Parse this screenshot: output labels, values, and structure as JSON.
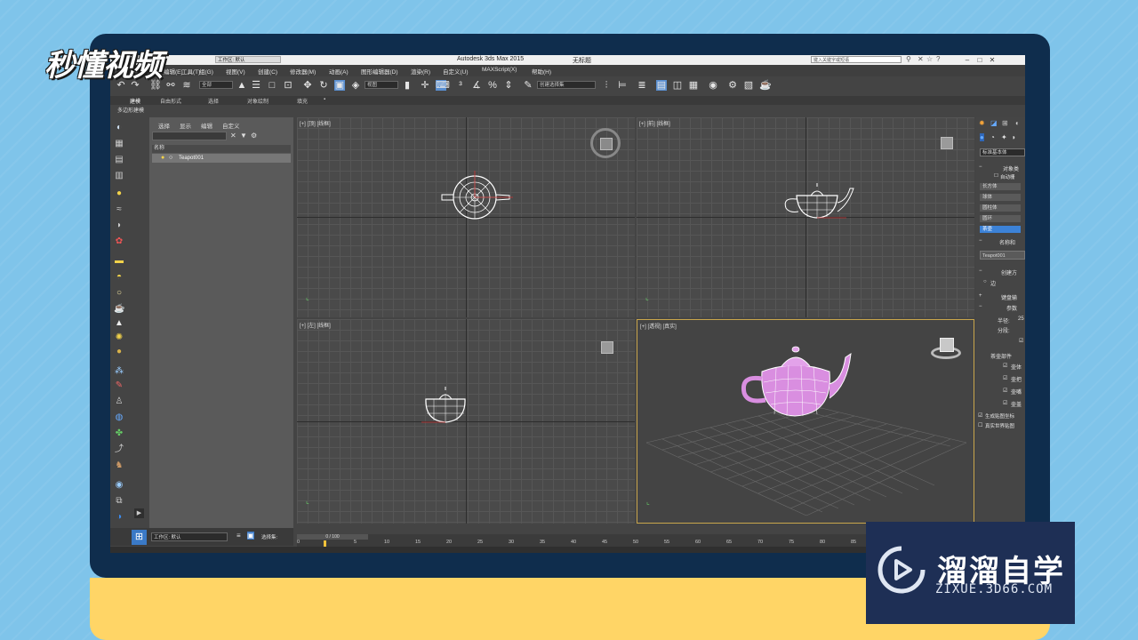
{
  "window": {
    "title": "Autodesk 3ds Max  2015",
    "doc_title": "无标题",
    "workspace": "工作区: 默认",
    "search_placeholder": "键入关键字或短语"
  },
  "menu": [
    "编辑(E)",
    "工具(T)",
    "组(G)",
    "视图(V)",
    "创建(C)",
    "修改器(M)",
    "动画(A)",
    "图形编辑器(D)",
    "渲染(R)",
    "自定义(U)",
    "MAXScript(X)",
    "帮助(H)"
  ],
  "toolbar": {
    "selection_filter": "全部",
    "view_dropdown": "视图",
    "named_selection": "创建选择集"
  },
  "ribbon_tabs": [
    "建模",
    "自由形式",
    "选择",
    "对象绘制",
    "填充"
  ],
  "ribbon_sub": "多边形建模",
  "scene_explorer": {
    "tabs": [
      "选择",
      "显示",
      "编辑",
      "自定义"
    ],
    "column_header": "名称",
    "items": [
      "Teapot001"
    ]
  },
  "viewports": [
    {
      "label": "[+] [顶] [线框]"
    },
    {
      "label": "[+] [前] [线框]"
    },
    {
      "label": "[+] [左] [线框]"
    },
    {
      "label": "[+] [透视] [真实]"
    }
  ],
  "command_panel": {
    "dropdown": "标准基本体",
    "object_type_title": "对象类",
    "autogrid": "自动栅",
    "buttons": [
      "长方体",
      "球体",
      "圆柱体",
      "圆环",
      "茶壶"
    ],
    "name_color_title": "名称和",
    "object_name": "Teapot001",
    "creation_method_title": "创建方",
    "edge_label": "边",
    "keyboard_entry_title": "键盘输",
    "parameters_title": "参数",
    "radius_label": "半径:",
    "radius_value": "25",
    "segments_label": "分段:",
    "teapot_parts_title": "茶壶部件",
    "parts": [
      "壶体",
      "壶把",
      "壶嘴",
      "壶盖"
    ],
    "gen_mapping": "生成贴图坐标",
    "real_world": "真实世界贴图"
  },
  "timeline": {
    "frame_counter": "0 / 100",
    "ticks": [
      "0",
      "5",
      "10",
      "15",
      "20",
      "25",
      "30",
      "35",
      "40",
      "45",
      "50",
      "55",
      "60",
      "65",
      "70",
      "75",
      "80",
      "85"
    ]
  },
  "bottom_left": {
    "workspace": "工作区: 默认",
    "selection_set": "选择集:"
  },
  "overlay": {
    "logo_text": "秒懂视频",
    "watermark_cn": "溜溜自学",
    "watermark_url": "ZIXUE.3D66.COM"
  },
  "colors": {
    "background": "#7fc4ea",
    "frame": "#0f2d4d",
    "accent_yellow": "#ffd566",
    "teapot": "#d98ee0",
    "watermark_bg": "#1e2f55"
  }
}
